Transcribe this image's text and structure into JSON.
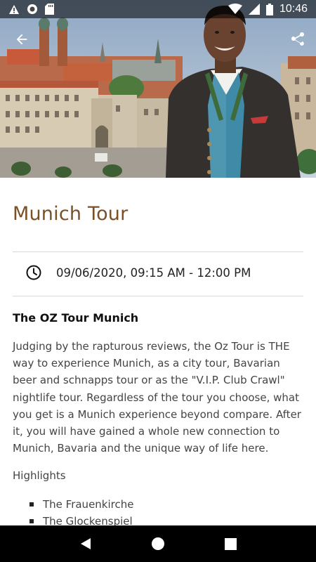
{
  "status_bar": {
    "time": "10:46",
    "icons": [
      "warning-icon",
      "circle-notification-icon",
      "sd-card-icon",
      "wifi-icon",
      "signal-icon",
      "battery-icon"
    ]
  },
  "hero": {
    "image": "munich-city-panorama-with-tour-guide-photo",
    "back_icon": "arrow-back-icon",
    "share_icon": "share-icon"
  },
  "event": {
    "title": "Munich Tour",
    "datetime": "09/06/2020, 09:15 AM - 12:00 PM",
    "datetime_icon": "clock-icon",
    "subheading": "The OZ Tour Munich",
    "description": "Judging by the rapturous reviews, the Oz Tour is THE way to experience Munich, as a city tour, Bavarian beer and schnapps tour or as the \"V.I.P. Club Crawl\" nightlife tour. Regardless of the tour you choose, what you get is a Munich experience beyond compare. After it, you will have gained a whole new connection to Munich, Bavaria and the unique way of life here.",
    "highlights_label": "Highlights",
    "highlights": [
      "The Frauenkirche",
      "The Glockenspiel"
    ]
  },
  "nav_bar": {
    "back_icon": "nav-back-icon",
    "home_icon": "nav-home-icon",
    "recents_icon": "nav-recents-icon"
  },
  "colors": {
    "title": "#7a5127",
    "divider": "#d9d9d9",
    "nav_bar": "#000000"
  }
}
